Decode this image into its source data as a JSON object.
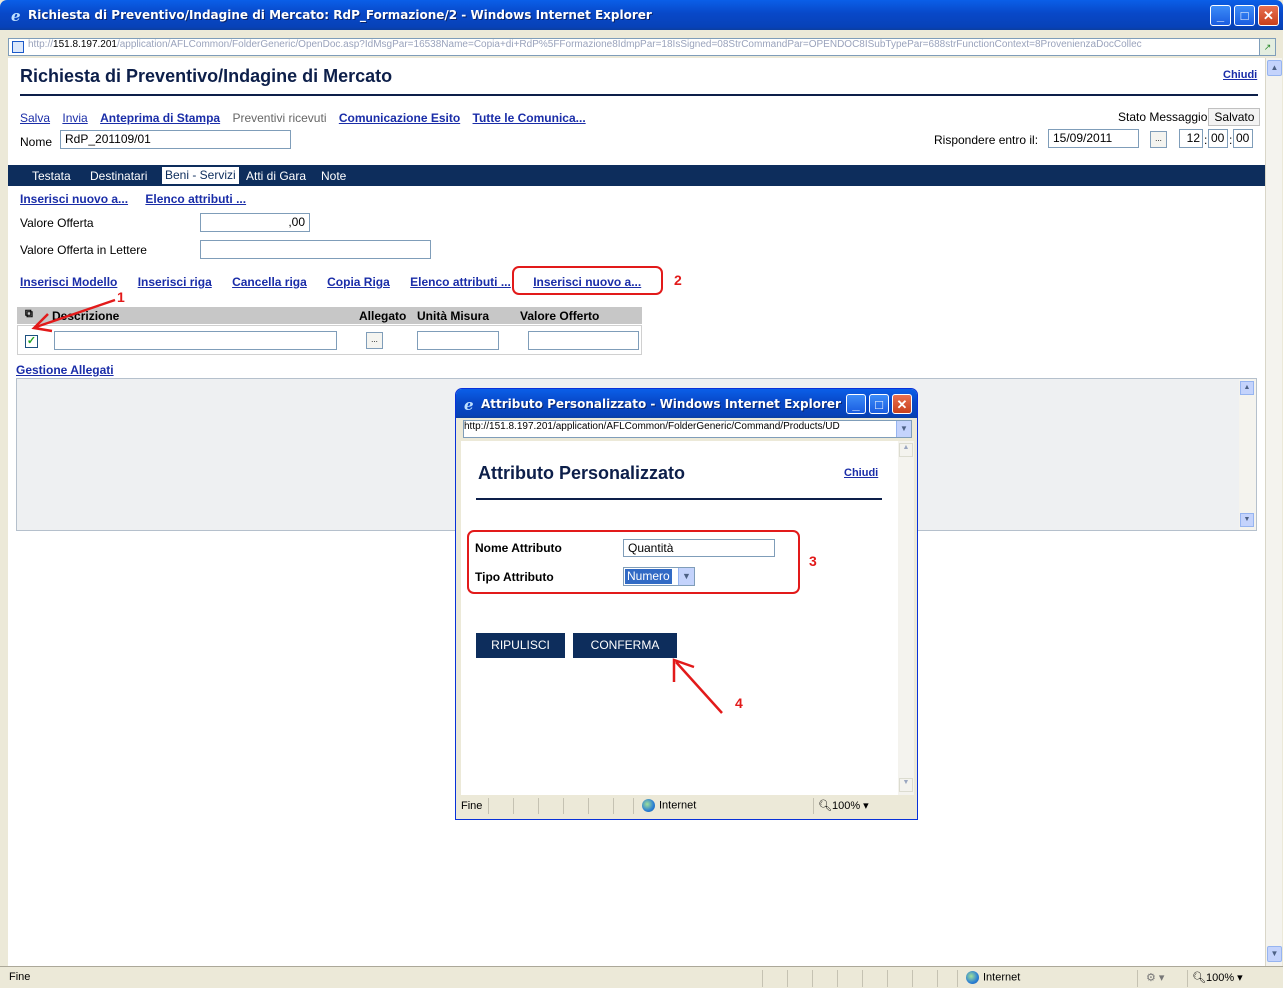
{
  "window": {
    "title": "Richiesta di Preventivo/Indagine di Mercato: RdP_Formazione/2 - Windows Internet Explorer",
    "address_prefix": "http://",
    "address_host": "151.8.197.201",
    "address_rest": "/application/AFLCommon/FolderGeneric/OpenDoc.asp?IdMsgPar=16538Name=Copia+di+RdP%5FFormazione8IdmpPar=18IsSigned=08StrCommandPar=OPENDOC8ISubTypePar=688strFunctionContext=8ProvenienzaDocCollec",
    "minimize_glyph": "_",
    "maximize_glyph": "□",
    "close_glyph": "✕"
  },
  "page": {
    "title": "Richiesta di Preventivo/Indagine di Mercato",
    "close_link": "Chiudi"
  },
  "toolbar": {
    "salva": "Salva",
    "invia": "Invia",
    "anteprima": "Anteprima di Stampa",
    "preventivi": "Preventivi ricevuti",
    "comunicazione": "Comunicazione Esito",
    "tutte": "Tutte le Comunica..."
  },
  "stato": {
    "label": "Stato Messaggio",
    "value": "Salvato"
  },
  "nome": {
    "label": "Nome",
    "value": "RdP_201109/01"
  },
  "rispondere": {
    "label": "Rispondere entro il:",
    "date": "15/09/2011",
    "date_btn": "...",
    "hour": "12",
    "minute": "00",
    "second": "00",
    "sep": ":"
  },
  "tabs": [
    {
      "label": "Testata"
    },
    {
      "label": "Destinatari"
    },
    {
      "label": "Beni - Servizi"
    },
    {
      "label": "Atti di Gara"
    },
    {
      "label": "Note"
    }
  ],
  "section_links": {
    "inserisci": "Inserisci nuovo a...",
    "elenco": "Elenco attributi ..."
  },
  "offerta": {
    "valore_label": "Valore Offerta",
    "valore_value": ",00",
    "lettere_label": "Valore Offerta in Lettere",
    "lettere_value": ""
  },
  "grid_links": {
    "modello": "Inserisci Modello",
    "riga": "Inserisci riga",
    "cancella": "Cancella riga",
    "copia": "Copia Riga",
    "elenco": "Elenco attributi ...",
    "nuovo": "Inserisci nuovo a..."
  },
  "grid": {
    "headers": {
      "descrizione": "Descrizione",
      "allegato": "Allegato",
      "unita": "Unità Misura",
      "valore": "Valore Offerto"
    },
    "row": {
      "checked": "✓",
      "descrizione": "",
      "allegato_btn": "...",
      "unita": "",
      "valore": ""
    }
  },
  "gestione_allegati": "Gestione Allegati",
  "annotations": [
    "1",
    "2",
    "3",
    "4"
  ],
  "popup": {
    "title": "Attributo Personalizzato - Windows Internet Explorer",
    "address": "http://151.8.197.201/application/AFLCommon/FolderGeneric/Command/Products/UD",
    "heading": "Attributo Personalizzato",
    "close_link": "Chiudi",
    "nome_label": "Nome Attributo",
    "nome_value": "Quantità",
    "tipo_label": "Tipo Attributo",
    "tipo_value": "Numero",
    "btn_ripulisci": "RIPULISCI",
    "btn_conferma": "CONFERMA",
    "status_text": "Fine",
    "status_zone": "Internet",
    "status_zoom": "100%"
  },
  "statusbar": {
    "text": "Fine",
    "zone": "Internet",
    "zoom": "100%"
  },
  "colors": {
    "accent_dark": "#0D2D5C",
    "link": "#1A2DA8",
    "annotation_red": "#E21A1A"
  }
}
